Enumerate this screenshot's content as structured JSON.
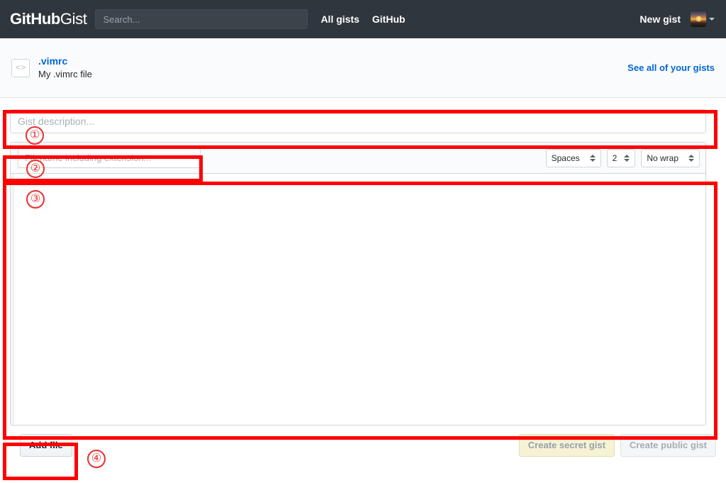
{
  "header": {
    "logo_bold": "GitHub",
    "logo_light": "Gist",
    "search_placeholder": "Search...",
    "search_value": "",
    "nav": [
      {
        "label": "All gists",
        "name": "all-gists"
      },
      {
        "label": "GitHub",
        "name": "github"
      }
    ],
    "new_gist_label": "New gist",
    "avatar_name": "user-avatar"
  },
  "subheader": {
    "icon": "code-icon",
    "icon_glyph": "<>",
    "gist_title": ".vimrc",
    "gist_description": "My .vimrc file",
    "see_all_label": "See all of your gists"
  },
  "form": {
    "description_placeholder": "Gist description...",
    "description_value": "",
    "filename_placeholder": "Filename including extension...",
    "filename_value": "",
    "editor_value": "",
    "indent_mode": {
      "label": "Spaces",
      "name": "indent-mode-select"
    },
    "indent_size": {
      "label": "2",
      "name": "indent-size-select"
    },
    "wrap_mode": {
      "label": "No wrap",
      "name": "wrap-mode-select"
    }
  },
  "actions": {
    "add_file_label": "Add file",
    "create_secret_label": "Create secret gist",
    "create_public_label": "Create public gist"
  },
  "annotations": {
    "markers": [
      "①",
      "②",
      "③",
      "④"
    ],
    "m1": "①",
    "m2": "②",
    "m3": "③",
    "m4": "④",
    "color": "#fe0000"
  }
}
